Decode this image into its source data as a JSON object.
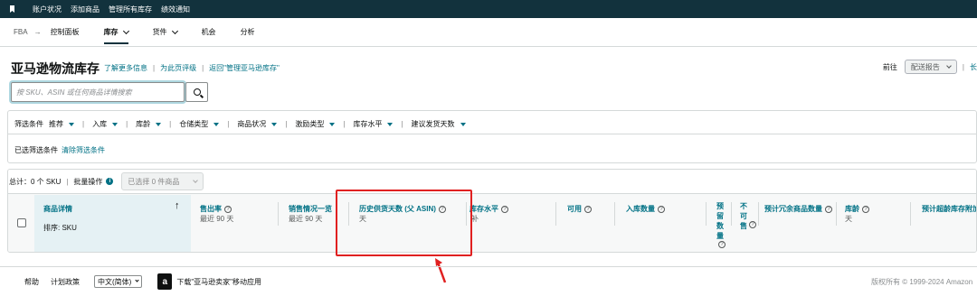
{
  "topbar": {
    "items": [
      "账户状况",
      "添加商品",
      "管理所有库存",
      "绩效通知"
    ]
  },
  "nav": {
    "fba": "FBA",
    "arrow": "→",
    "items": [
      {
        "label": "控制面板",
        "dropdown": false,
        "active": false
      },
      {
        "label": "库存",
        "dropdown": true,
        "active": true
      },
      {
        "label": "货件",
        "dropdown": true,
        "active": false
      },
      {
        "label": "机会",
        "dropdown": false,
        "active": false
      },
      {
        "label": "分析",
        "dropdown": false,
        "active": false
      }
    ]
  },
  "header": {
    "title": "亚马逊物流库存",
    "links": [
      "了解更多信息",
      "为此页评级",
      "返回\"管理亚马逊库存\""
    ],
    "goto_label": "前往",
    "goto_value": "配送报告",
    "trunc_link": "长"
  },
  "search": {
    "placeholder": "按 SKU、ASIN 或任何商品详情搜索"
  },
  "filters": {
    "label": "筛选条件",
    "items": [
      "推荐",
      "入库",
      "库龄",
      "仓储类型",
      "商品状况",
      "激励类型",
      "库存水平",
      "建议发货天数"
    ],
    "selected_label": "已选筛选条件",
    "clear_link": "清除筛选条件"
  },
  "table": {
    "total": "总计：0 个 SKU",
    "bulk_label": "批量操作",
    "bulk_select": "已选择 0 件商品",
    "product_col": {
      "header": "商品详情",
      "sort": "排序: SKU"
    },
    "columns": [
      {
        "header": "售出率",
        "sub": "最近 90 天"
      },
      {
        "header": "销售情况一览",
        "sub": "最近 90 天"
      },
      {
        "header": "历史供货天数 (父 ASIN)",
        "sub": "天"
      },
      {
        "header": "库存水平",
        "sub": "补"
      },
      {
        "header": "可用",
        "sub": ""
      },
      {
        "header": "入库数量",
        "sub": ""
      },
      {
        "header": "预留数量",
        "sub": ""
      },
      {
        "header": "不可售",
        "sub": ""
      },
      {
        "header": "预计冗余商品数量",
        "sub": ""
      },
      {
        "header": "库龄",
        "sub": "天"
      },
      {
        "header": "预计超龄库存附加",
        "sub": ""
      }
    ]
  },
  "footer": {
    "help": "帮助",
    "policy": "计划政策",
    "language": "中文(简体)",
    "app_logo": "a",
    "app_text": "下载\"亚马逊卖家\"移动应用",
    "copyright": "版权所有 © 1999-2024 Amazon"
  },
  "colors": {
    "accent": "#007185",
    "topbar": "#12323d",
    "callout": "#e02020"
  }
}
